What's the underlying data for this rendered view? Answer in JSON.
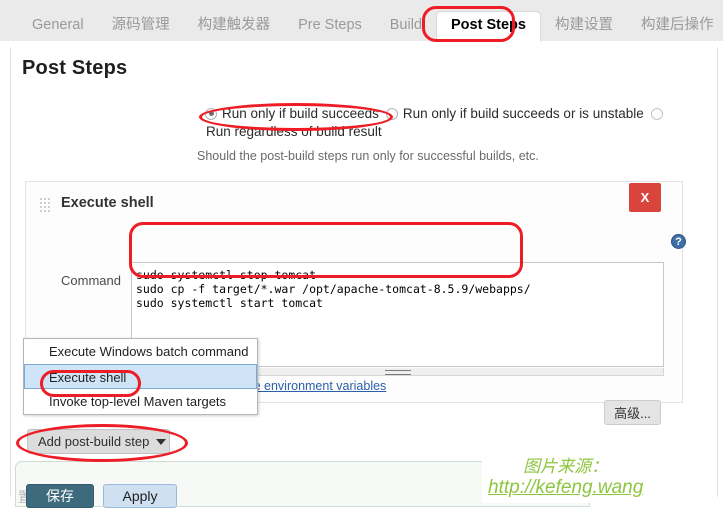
{
  "tabs": [
    {
      "label": "General",
      "active": false
    },
    {
      "label": "源码管理",
      "active": false
    },
    {
      "label": "构建触发器",
      "active": false
    },
    {
      "label": "Pre Steps",
      "active": false
    },
    {
      "label": "Build",
      "active": false
    },
    {
      "label": "Post Steps",
      "active": true
    },
    {
      "label": "构建设置",
      "active": false
    },
    {
      "label": "构建后操作",
      "active": false
    }
  ],
  "page": {
    "title": "Post Steps",
    "help_text": "Should the post-build steps run only for successful builds, etc."
  },
  "run_condition": {
    "option1": "Run only if build succeeds",
    "option2": "Run only if build succeeds or is unstable",
    "option3": "Run regardless of build result",
    "selected": "Run only if build succeeds"
  },
  "step": {
    "title": "Execute shell",
    "delete_label": "X",
    "help_label": "?",
    "command_label": "Command",
    "command_value": "sudo systemctl stop tomcat\nsudo cp -f target/*.war /opt/apache-tomcat-8.5.9/webapps/\nsudo systemctl start tomcat",
    "env_link": "See the list of available environment variables",
    "advanced_label": "高级..."
  },
  "dropdown": {
    "items": [
      {
        "label": "Execute Windows batch command",
        "selected": false
      },
      {
        "label": "Execute shell",
        "selected": true
      },
      {
        "label": "Invoke top-level Maven targets",
        "selected": false
      }
    ]
  },
  "add_step": {
    "label": "Add post-build step"
  },
  "footer": {
    "save_label": "保存",
    "apply_label": "Apply",
    "ghost_label": "置"
  },
  "watermark": {
    "line1": "图片来源：",
    "line2": "http://kefeng.wang",
    "color": "#8dc63f"
  },
  "annotation_color": "#ee1c25"
}
